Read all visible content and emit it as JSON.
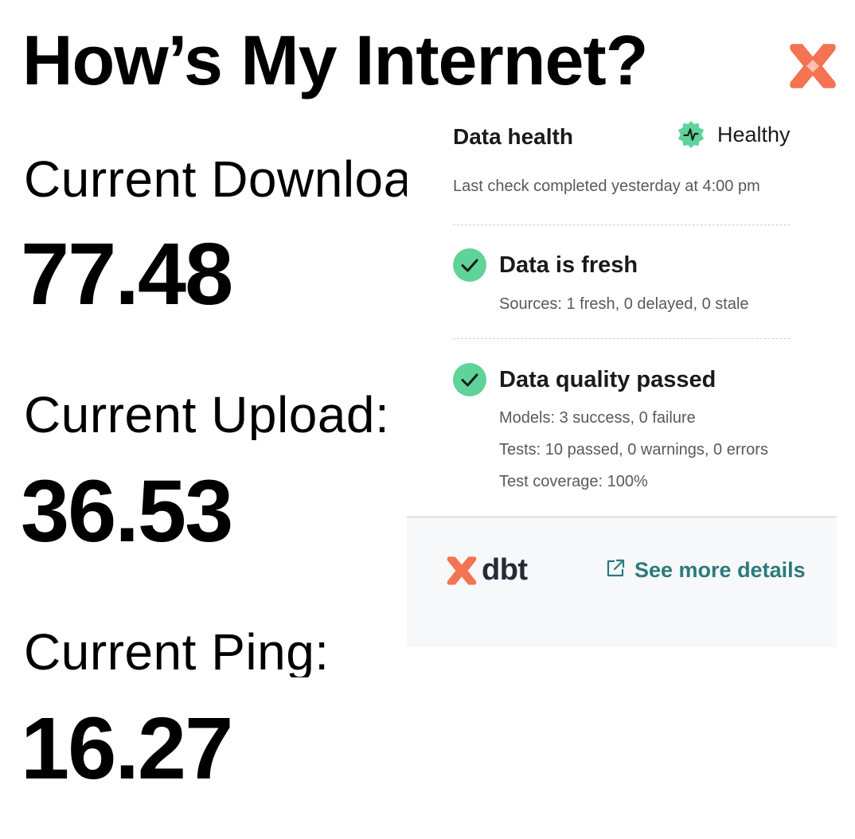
{
  "page": {
    "title": "How’s My Internet?"
  },
  "metrics": [
    {
      "label": "Current Download:",
      "value": "77.48"
    },
    {
      "label": "Current Upload:",
      "value": "36.53"
    },
    {
      "label": "Current Ping:",
      "value": "16.27"
    }
  ],
  "health": {
    "header": "Data health",
    "status": "Healthy",
    "last_check": "Last check completed yesterday at 4:00 pm",
    "freshness": {
      "title": "Data is fresh",
      "sources": "Sources: 1 fresh, 0 delayed, 0 stale"
    },
    "quality": {
      "title": "Data quality passed",
      "models": "Models: 3 success, 0 failure",
      "tests": "Tests: 10 passed, 0 warnings, 0 errors",
      "coverage": "Test coverage: 100%"
    },
    "footer": {
      "brand": "dbt",
      "link_label": "See more details"
    }
  },
  "icons": {
    "corner_logo": "dbt-logo-icon",
    "status_badge": "healthy-pulse-icon",
    "check": "check-circle-icon",
    "external_link": "external-link-icon"
  },
  "colors": {
    "dbt_orange": "#f37352",
    "success_green": "#5fd39a",
    "link_teal": "#2c7a7b",
    "text_dark": "#1a1a1a",
    "text_muted": "#555a60",
    "footer_bg": "#f7f8f9"
  }
}
